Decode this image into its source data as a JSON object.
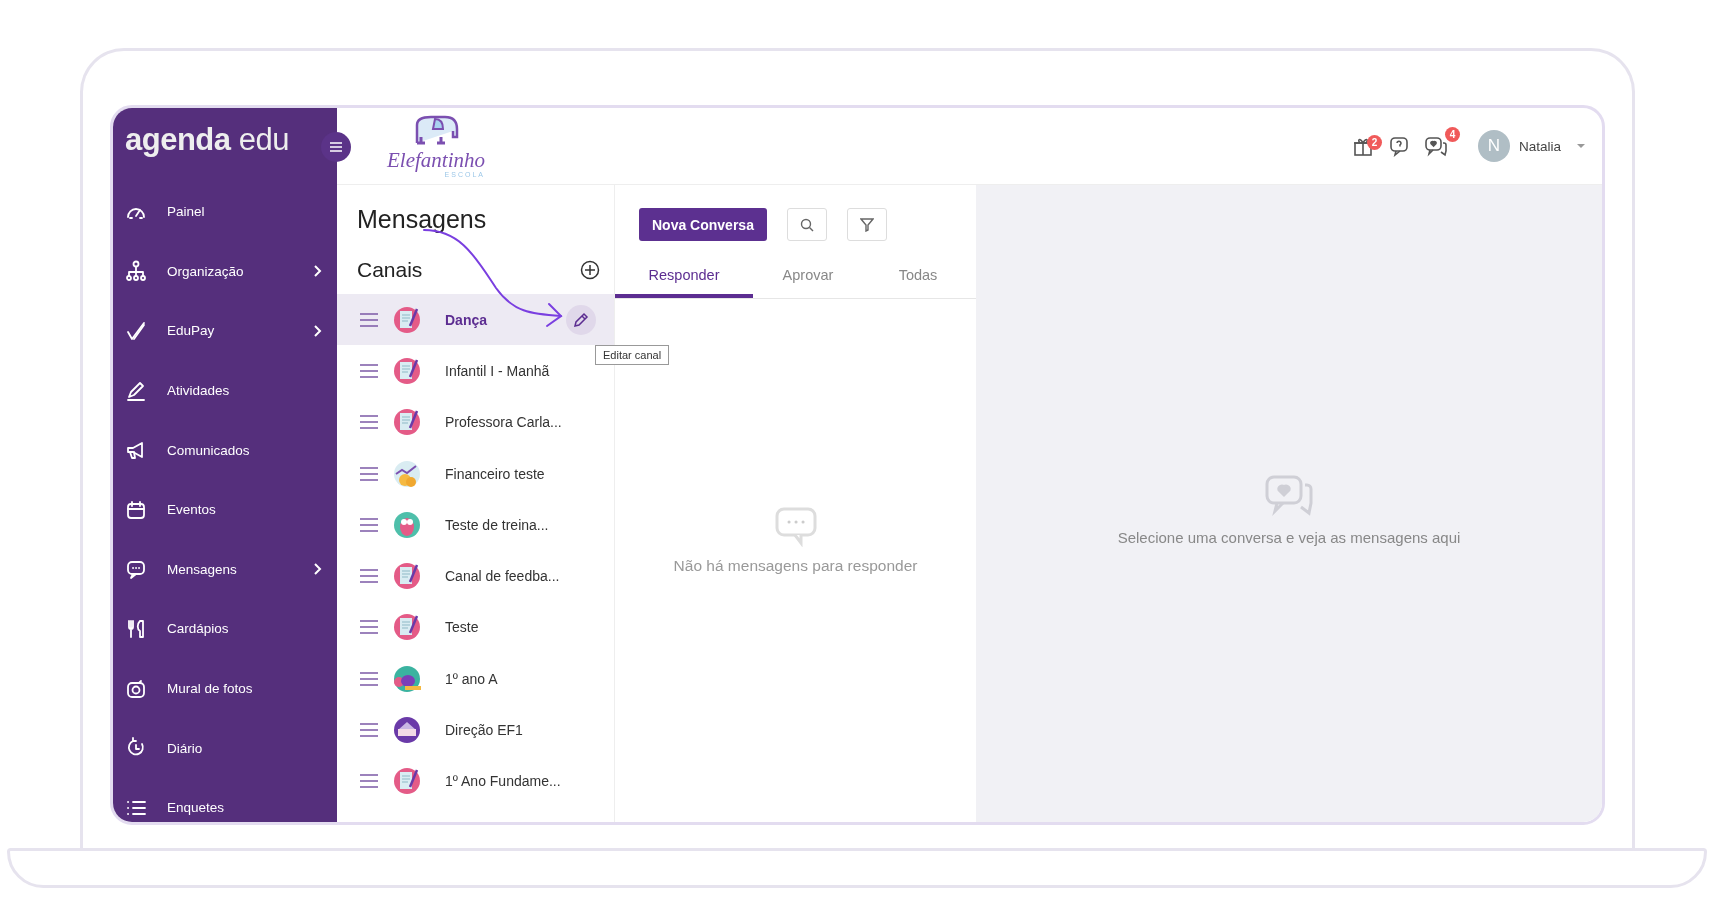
{
  "sidebar": {
    "logo": "**agenda** edu",
    "items": [
      {
        "label": "Painel",
        "has_submenu": false
      },
      {
        "label": "Organização",
        "has_submenu": true
      },
      {
        "label": "EduPay",
        "has_submenu": true
      },
      {
        "label": "Atividades",
        "has_submenu": false
      },
      {
        "label": "Comunicados",
        "has_submenu": false
      },
      {
        "label": "Eventos",
        "has_submenu": false
      },
      {
        "label": "Mensagens",
        "has_submenu": true
      },
      {
        "label": "Cardápios",
        "has_submenu": false
      },
      {
        "label": "Mural de fotos",
        "has_submenu": false
      },
      {
        "label": "Diário",
        "has_submenu": false
      },
      {
        "label": "Enquetes",
        "has_submenu": false
      }
    ]
  },
  "school_logo": {
    "name": "Elefantinho",
    "subtitle": "ESCOLA"
  },
  "topbar": {
    "gift_badge": "2",
    "messages_badge": "4",
    "user": {
      "initial": "N",
      "name": "Natalia"
    }
  },
  "channels": {
    "title": "Mensagens",
    "subtitle": "Canais",
    "tooltip": "Editar canal",
    "items": [
      {
        "name": "Dança",
        "selected": true
      },
      {
        "name": "Infantil I - Manhã",
        "selected": false
      },
      {
        "name": "Professora Carla...",
        "selected": false
      },
      {
        "name": "Financeiro teste",
        "selected": false
      },
      {
        "name": "Teste de treina...",
        "selected": false
      },
      {
        "name": "Canal de feedba...",
        "selected": false
      },
      {
        "name": "Teste",
        "selected": false
      },
      {
        "name": "1º ano A",
        "selected": false
      },
      {
        "name": "Direção EF1",
        "selected": false
      },
      {
        "name": "1º Ano Fundame...",
        "selected": false
      }
    ]
  },
  "conversations": {
    "new_button": "Nova Conversa",
    "tabs": [
      {
        "label": "Responder",
        "selected": true
      },
      {
        "label": "Aprovar",
        "selected": false
      },
      {
        "label": "Todas",
        "selected": false
      }
    ],
    "empty_text": "Não há mensagens para responder"
  },
  "detail": {
    "empty_text": "Selecione uma conversa e veja as mensagens aqui"
  }
}
